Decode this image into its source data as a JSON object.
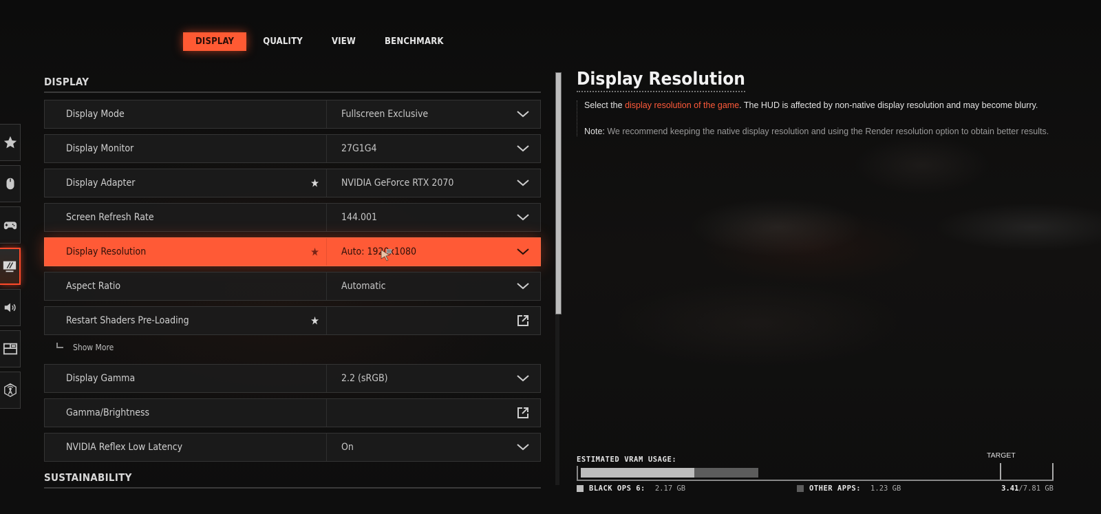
{
  "tabs": [
    {
      "label": "DISPLAY",
      "active": true
    },
    {
      "label": "QUALITY",
      "active": false
    },
    {
      "label": "VIEW",
      "active": false
    },
    {
      "label": "BENCHMARK",
      "active": false
    }
  ],
  "sidebar": {
    "items": [
      {
        "icon": "star-icon",
        "active": false
      },
      {
        "icon": "mouse-icon",
        "active": false
      },
      {
        "icon": "gamepad-icon",
        "active": false
      },
      {
        "icon": "monitor-icon",
        "active": true
      },
      {
        "icon": "speaker-icon",
        "active": false
      },
      {
        "icon": "layout-icon",
        "active": false
      },
      {
        "icon": "network-icon",
        "active": false
      }
    ]
  },
  "sections": {
    "display": {
      "title": "DISPLAY",
      "rows": [
        {
          "label": "Display Mode",
          "value": "Fullscreen Exclusive",
          "control": "dropdown",
          "starred": false
        },
        {
          "label": "Display Monitor",
          "value": "27G1G4",
          "control": "dropdown",
          "starred": false
        },
        {
          "label": "Display Adapter",
          "value": "NVIDIA GeForce RTX 2070",
          "control": "dropdown",
          "starred": true
        },
        {
          "label": "Screen Refresh Rate",
          "value": "144.001",
          "control": "dropdown",
          "starred": false
        },
        {
          "label": "Display Resolution",
          "value": "Auto: 1920x1080",
          "control": "dropdown",
          "starred": true,
          "active": true
        },
        {
          "label": "Aspect Ratio",
          "value": "Automatic",
          "control": "dropdown",
          "starred": false
        },
        {
          "label": "Restart Shaders Pre-Loading",
          "value": "",
          "control": "external",
          "starred": true
        }
      ],
      "show_more": "Show More",
      "rows2": [
        {
          "label": "Display Gamma",
          "value": "2.2 (sRGB)",
          "control": "dropdown",
          "starred": false
        },
        {
          "label": "Gamma/Brightness",
          "value": "",
          "control": "external",
          "starred": false
        },
        {
          "label": "NVIDIA Reflex Low Latency",
          "value": "On",
          "control": "dropdown",
          "starred": false
        }
      ]
    },
    "sustainability": {
      "title": "SUSTAINABILITY"
    }
  },
  "info": {
    "title": "Display Resolution",
    "desc_pre": "Select the ",
    "desc_highlight": "display resolution of the game",
    "desc_post": ". The HUD is affected by non-native display resolution and may become blurry.",
    "note_label": "Note:",
    "note_text": " We recommend keeping the native display resolution and using the Render resolution option to obtain better results."
  },
  "vram": {
    "title": "ESTIMATED VRAM USAGE:",
    "target_label": "TARGET",
    "black_ops_label": "BLACK OPS 6:",
    "black_ops_value": "2.17 GB",
    "black_ops_gb": 2.17,
    "other_label": "OTHER APPS:",
    "other_value": "1.23 GB",
    "other_gb": 1.23,
    "total_used": "3.41",
    "total_available": "/7.81 GB",
    "total_gb": 7.81,
    "target_gb": 7.0
  },
  "colors": {
    "accent": "#ff5a36",
    "highlight_text": "#ff5a3a",
    "vram_game": "#bdbdbd",
    "vram_other": "#5c5c5c"
  }
}
